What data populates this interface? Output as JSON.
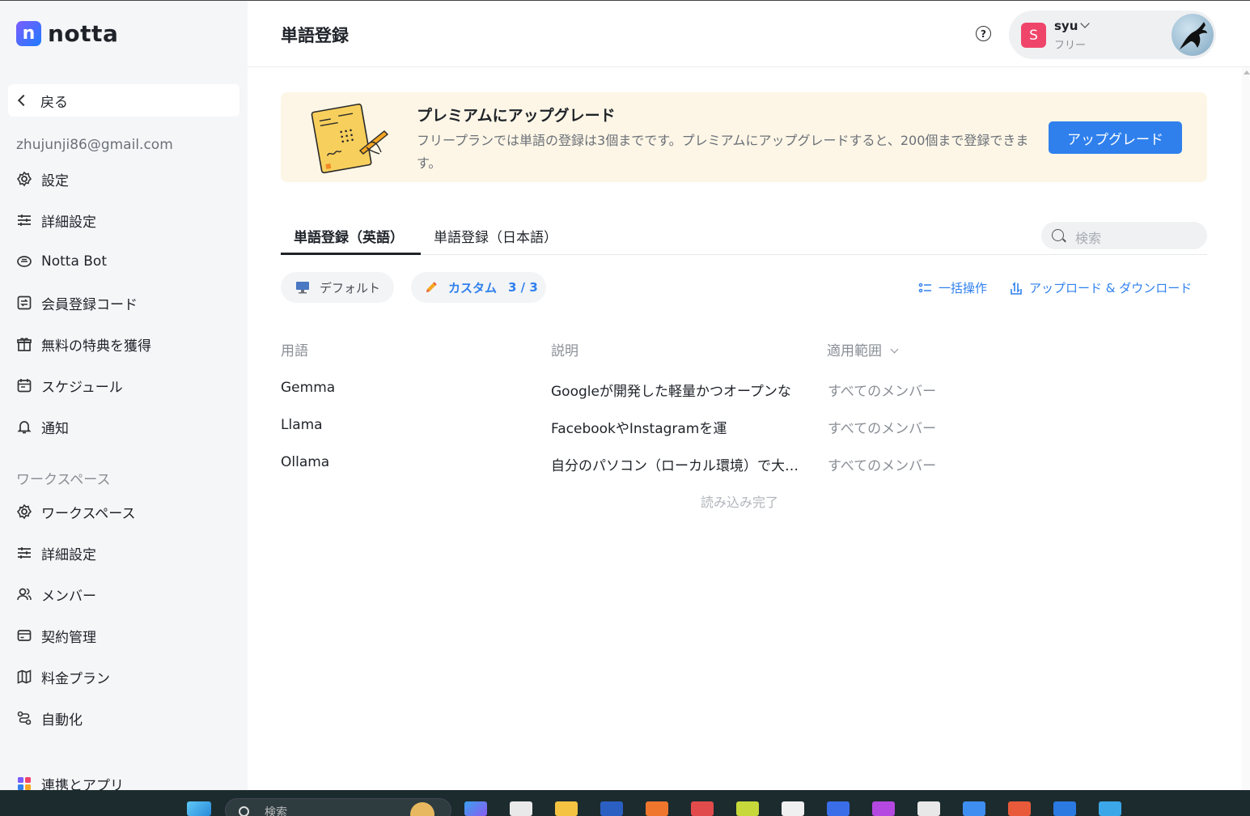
{
  "app": {
    "logo_text": "notta",
    "logo_mark": "n"
  },
  "sidebar": {
    "back_label": "戻る",
    "email": "zhujunji86@gmail.com",
    "account_items": [
      {
        "label": "設定",
        "icon": "gear-icon"
      },
      {
        "label": "詳細設定",
        "icon": "sliders-icon"
      },
      {
        "label": "Notta Bot",
        "icon": "bot-icon"
      },
      {
        "label": "会員登録コード",
        "icon": "code-icon"
      },
      {
        "label": "無料の特典を獲得",
        "icon": "gift-icon"
      },
      {
        "label": "スケジュール",
        "icon": "calendar-icon"
      },
      {
        "label": "通知",
        "icon": "bell-icon"
      }
    ],
    "workspace_label": "ワークスペース",
    "workspace_items": [
      {
        "label": "ワークスペース",
        "icon": "gear-icon"
      },
      {
        "label": "詳細設定",
        "icon": "sliders-icon"
      },
      {
        "label": "メンバー",
        "icon": "members-icon"
      },
      {
        "label": "契約管理",
        "icon": "card-icon"
      },
      {
        "label": "料金プラン",
        "icon": "map-icon"
      },
      {
        "label": "自動化",
        "icon": "automation-icon"
      }
    ],
    "integrations_label": "連携とアプリ"
  },
  "header": {
    "title": "単語登録",
    "user": {
      "initial": "S",
      "name": "syu",
      "plan": "フリー"
    }
  },
  "banner": {
    "title": "プレミアムにアップグレード",
    "description": "フリープランでは単語の登録は3個までです。プレミアムにアップグレードすると、200個まで登録できます。",
    "button": "アップグレード"
  },
  "tabs": [
    {
      "label": "単語登録（英語）",
      "active": true
    },
    {
      "label": "単語登録（日本語）",
      "active": false
    }
  ],
  "search": {
    "placeholder": "検索"
  },
  "filters": {
    "default_label": "デフォルト",
    "custom_label": "カスタム",
    "custom_count": "3 / 3"
  },
  "actions": {
    "bulk": "一括操作",
    "upload_download": "アップロード & ダウンロード"
  },
  "table": {
    "headers": {
      "term": "用語",
      "description": "説明",
      "scope": "適用範囲"
    },
    "rows": [
      {
        "term": "Gemma",
        "description": "Googleが開発した軽量かつオープンな",
        "scope": "すべてのメンバー"
      },
      {
        "term": "Llama",
        "description": "FacebookやInstagramを運",
        "scope": "すべてのメンバー"
      },
      {
        "term": "Ollama",
        "description": "自分のパソコン（ローカル環境）で大規模言語モデルを動かすツール",
        "scope": "すべてのメンバー"
      }
    ],
    "footer": "読み込み完了"
  },
  "taskbar": {
    "search_placeholder": "検索"
  },
  "colors": {
    "accent": "#2f80ed",
    "banner_bg": "#fdf6e6",
    "avatar_s": "#f0456a"
  }
}
